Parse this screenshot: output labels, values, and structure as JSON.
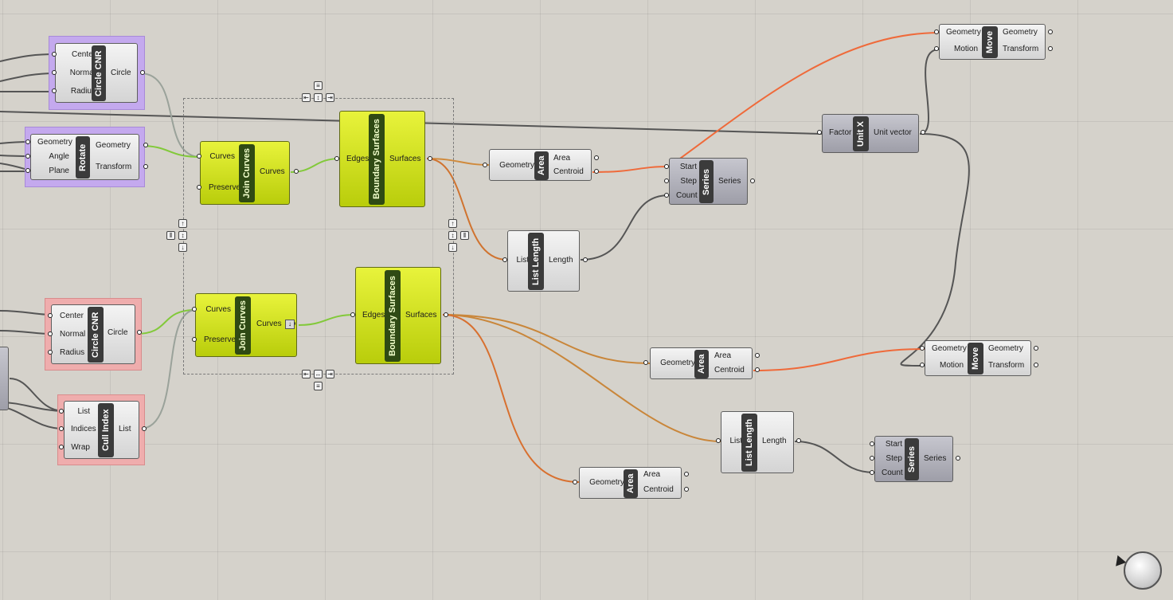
{
  "canvas": {
    "background": "#d5d2cb",
    "grid": true
  },
  "wire_colors": {
    "default": "#555555",
    "selected_green": "#82c93a",
    "highlight_orange": "#ef6a3a",
    "faded": "#9aa29a"
  },
  "components": {
    "circle_cnr_1": {
      "title": "Circle CNR",
      "inputs": [
        "Center",
        "Normal",
        "Radius"
      ],
      "outputs": [
        "Circle"
      ]
    },
    "rotate": {
      "title": "Rotate",
      "inputs": [
        "Geometry",
        "Angle",
        "Plane"
      ],
      "outputs": [
        "Geometry",
        "Transform"
      ]
    },
    "join_curves_1": {
      "title": "Join Curves",
      "inputs": [
        "Curves",
        "Preserve"
      ],
      "outputs": [
        "Curves"
      ]
    },
    "boundary_surfaces_1": {
      "title": "Boundary Surfaces",
      "inputs": [
        "Edges"
      ],
      "outputs": [
        "Surfaces"
      ]
    },
    "area_1": {
      "title": "Area",
      "inputs": [
        "Geometry"
      ],
      "outputs": [
        "Area",
        "Centroid"
      ]
    },
    "list_length_1": {
      "title": "List Length",
      "inputs": [
        "List"
      ],
      "outputs": [
        "Length"
      ]
    },
    "series_1": {
      "title": "Series",
      "inputs": [
        "Start",
        "Step",
        "Count"
      ],
      "outputs": [
        "Series"
      ]
    },
    "move_1": {
      "title": "Move",
      "inputs": [
        "Geometry",
        "Motion"
      ],
      "outputs": [
        "Geometry",
        "Transform"
      ]
    },
    "unit_x": {
      "title": "Unit X",
      "inputs": [
        "Factor"
      ],
      "outputs": [
        "Unit vector"
      ]
    },
    "circle_cnr_2": {
      "title": "Circle CNR",
      "inputs": [
        "Center",
        "Normal",
        "Radius"
      ],
      "outputs": [
        "Circle"
      ]
    },
    "cull_index": {
      "title": "Cull Index",
      "inputs": [
        "List",
        "Indices",
        "Wrap"
      ],
      "outputs": [
        "List"
      ]
    },
    "join_curves_2": {
      "title": "Join Curves",
      "inputs": [
        "Curves",
        "Preserve"
      ],
      "outputs": [
        "Curves"
      ]
    },
    "boundary_surfaces_2": {
      "title": "Boundary Surfaces",
      "inputs": [
        "Edges"
      ],
      "outputs": [
        "Surfaces"
      ]
    },
    "area_2": {
      "title": "Area",
      "inputs": [
        "Geometry"
      ],
      "outputs": [
        "Area",
        "Centroid"
      ]
    },
    "move_2": {
      "title": "Move",
      "inputs": [
        "Geometry",
        "Motion"
      ],
      "outputs": [
        "Geometry",
        "Transform"
      ]
    },
    "list_length_2": {
      "title": "List Length",
      "inputs": [
        "List"
      ],
      "outputs": [
        "Length"
      ]
    },
    "series_2": {
      "title": "Series",
      "inputs": [
        "Start",
        "Step",
        "Count"
      ],
      "outputs": [
        "Series"
      ]
    },
    "area_3": {
      "title": "Area",
      "inputs": [
        "Geometry"
      ],
      "outputs": [
        "Area",
        "Centroid"
      ]
    }
  },
  "icons": {
    "navigation": "navigation-compass-icon",
    "align_widget": "align-widget-icon",
    "flag": "flatten-flag-icon"
  }
}
